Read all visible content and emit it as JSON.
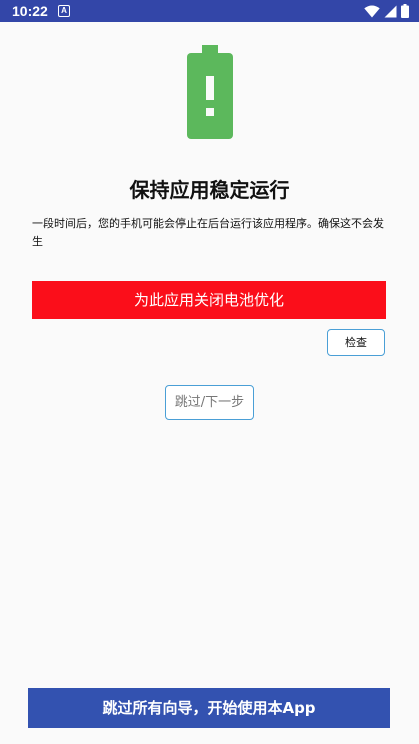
{
  "status_bar": {
    "time": "10:22",
    "notification_glyph": "A",
    "icons": [
      "wifi-icon",
      "signal-icon",
      "battery-icon"
    ],
    "background": "#3346a8"
  },
  "hero": {
    "icon": "battery-alert-icon",
    "color": "#5cb85c"
  },
  "title": "保持应用稳定运行",
  "description": "一段时间后，您的手机可能会停止在后台运行该应用程序。确保这不会发生",
  "buttons": {
    "disable_optimization": "为此应用关闭电池优化",
    "check": "检查",
    "skip_next": "跳过/下一步",
    "skip_all": "跳过所有向导，开始使用本App"
  },
  "colors": {
    "primary_button": "#fb0e1a",
    "bottom_button": "#3352b0",
    "outline": "#4a9fd6"
  }
}
